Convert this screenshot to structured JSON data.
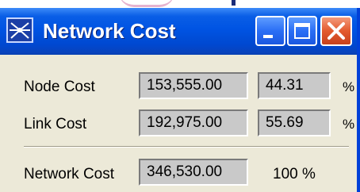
{
  "window": {
    "title": "Network Cost",
    "icon": "network-app-icon"
  },
  "rows": [
    {
      "label": "Node Cost",
      "cost": "153,555.00",
      "percent": "44.31",
      "percent_sign": "%"
    },
    {
      "label": "Link Cost",
      "cost": "192,975.00",
      "percent": "55.69",
      "percent_sign": "%"
    }
  ],
  "total": {
    "label": "Network Cost",
    "cost": "346,530.00",
    "percent": "100 %"
  },
  "colors": {
    "titlebar": "#0054e3",
    "window_bg": "#ece9d8",
    "field_bg": "#c9c9c9",
    "close_button": "#e35a2e"
  }
}
